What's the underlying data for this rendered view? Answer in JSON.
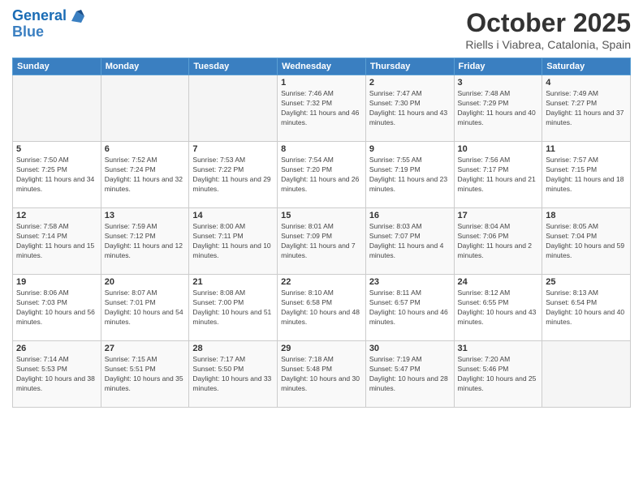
{
  "app": {
    "logo_line1": "General",
    "logo_line2": "Blue"
  },
  "header": {
    "month": "October 2025",
    "location": "Riells i Viabrea, Catalonia, Spain"
  },
  "weekdays": [
    "Sunday",
    "Monday",
    "Tuesday",
    "Wednesday",
    "Thursday",
    "Friday",
    "Saturday"
  ],
  "weeks": [
    [
      {
        "day": "",
        "sunrise": "",
        "sunset": "",
        "daylight": ""
      },
      {
        "day": "",
        "sunrise": "",
        "sunset": "",
        "daylight": ""
      },
      {
        "day": "",
        "sunrise": "",
        "sunset": "",
        "daylight": ""
      },
      {
        "day": "1",
        "sunrise": "Sunrise: 7:46 AM",
        "sunset": "Sunset: 7:32 PM",
        "daylight": "Daylight: 11 hours and 46 minutes."
      },
      {
        "day": "2",
        "sunrise": "Sunrise: 7:47 AM",
        "sunset": "Sunset: 7:30 PM",
        "daylight": "Daylight: 11 hours and 43 minutes."
      },
      {
        "day": "3",
        "sunrise": "Sunrise: 7:48 AM",
        "sunset": "Sunset: 7:29 PM",
        "daylight": "Daylight: 11 hours and 40 minutes."
      },
      {
        "day": "4",
        "sunrise": "Sunrise: 7:49 AM",
        "sunset": "Sunset: 7:27 PM",
        "daylight": "Daylight: 11 hours and 37 minutes."
      }
    ],
    [
      {
        "day": "5",
        "sunrise": "Sunrise: 7:50 AM",
        "sunset": "Sunset: 7:25 PM",
        "daylight": "Daylight: 11 hours and 34 minutes."
      },
      {
        "day": "6",
        "sunrise": "Sunrise: 7:52 AM",
        "sunset": "Sunset: 7:24 PM",
        "daylight": "Daylight: 11 hours and 32 minutes."
      },
      {
        "day": "7",
        "sunrise": "Sunrise: 7:53 AM",
        "sunset": "Sunset: 7:22 PM",
        "daylight": "Daylight: 11 hours and 29 minutes."
      },
      {
        "day": "8",
        "sunrise": "Sunrise: 7:54 AM",
        "sunset": "Sunset: 7:20 PM",
        "daylight": "Daylight: 11 hours and 26 minutes."
      },
      {
        "day": "9",
        "sunrise": "Sunrise: 7:55 AM",
        "sunset": "Sunset: 7:19 PM",
        "daylight": "Daylight: 11 hours and 23 minutes."
      },
      {
        "day": "10",
        "sunrise": "Sunrise: 7:56 AM",
        "sunset": "Sunset: 7:17 PM",
        "daylight": "Daylight: 11 hours and 21 minutes."
      },
      {
        "day": "11",
        "sunrise": "Sunrise: 7:57 AM",
        "sunset": "Sunset: 7:15 PM",
        "daylight": "Daylight: 11 hours and 18 minutes."
      }
    ],
    [
      {
        "day": "12",
        "sunrise": "Sunrise: 7:58 AM",
        "sunset": "Sunset: 7:14 PM",
        "daylight": "Daylight: 11 hours and 15 minutes."
      },
      {
        "day": "13",
        "sunrise": "Sunrise: 7:59 AM",
        "sunset": "Sunset: 7:12 PM",
        "daylight": "Daylight: 11 hours and 12 minutes."
      },
      {
        "day": "14",
        "sunrise": "Sunrise: 8:00 AM",
        "sunset": "Sunset: 7:11 PM",
        "daylight": "Daylight: 11 hours and 10 minutes."
      },
      {
        "day": "15",
        "sunrise": "Sunrise: 8:01 AM",
        "sunset": "Sunset: 7:09 PM",
        "daylight": "Daylight: 11 hours and 7 minutes."
      },
      {
        "day": "16",
        "sunrise": "Sunrise: 8:03 AM",
        "sunset": "Sunset: 7:07 PM",
        "daylight": "Daylight: 11 hours and 4 minutes."
      },
      {
        "day": "17",
        "sunrise": "Sunrise: 8:04 AM",
        "sunset": "Sunset: 7:06 PM",
        "daylight": "Daylight: 11 hours and 2 minutes."
      },
      {
        "day": "18",
        "sunrise": "Sunrise: 8:05 AM",
        "sunset": "Sunset: 7:04 PM",
        "daylight": "Daylight: 10 hours and 59 minutes."
      }
    ],
    [
      {
        "day": "19",
        "sunrise": "Sunrise: 8:06 AM",
        "sunset": "Sunset: 7:03 PM",
        "daylight": "Daylight: 10 hours and 56 minutes."
      },
      {
        "day": "20",
        "sunrise": "Sunrise: 8:07 AM",
        "sunset": "Sunset: 7:01 PM",
        "daylight": "Daylight: 10 hours and 54 minutes."
      },
      {
        "day": "21",
        "sunrise": "Sunrise: 8:08 AM",
        "sunset": "Sunset: 7:00 PM",
        "daylight": "Daylight: 10 hours and 51 minutes."
      },
      {
        "day": "22",
        "sunrise": "Sunrise: 8:10 AM",
        "sunset": "Sunset: 6:58 PM",
        "daylight": "Daylight: 10 hours and 48 minutes."
      },
      {
        "day": "23",
        "sunrise": "Sunrise: 8:11 AM",
        "sunset": "Sunset: 6:57 PM",
        "daylight": "Daylight: 10 hours and 46 minutes."
      },
      {
        "day": "24",
        "sunrise": "Sunrise: 8:12 AM",
        "sunset": "Sunset: 6:55 PM",
        "daylight": "Daylight: 10 hours and 43 minutes."
      },
      {
        "day": "25",
        "sunrise": "Sunrise: 8:13 AM",
        "sunset": "Sunset: 6:54 PM",
        "daylight": "Daylight: 10 hours and 40 minutes."
      }
    ],
    [
      {
        "day": "26",
        "sunrise": "Sunrise: 7:14 AM",
        "sunset": "Sunset: 5:53 PM",
        "daylight": "Daylight: 10 hours and 38 minutes."
      },
      {
        "day": "27",
        "sunrise": "Sunrise: 7:15 AM",
        "sunset": "Sunset: 5:51 PM",
        "daylight": "Daylight: 10 hours and 35 minutes."
      },
      {
        "day": "28",
        "sunrise": "Sunrise: 7:17 AM",
        "sunset": "Sunset: 5:50 PM",
        "daylight": "Daylight: 10 hours and 33 minutes."
      },
      {
        "day": "29",
        "sunrise": "Sunrise: 7:18 AM",
        "sunset": "Sunset: 5:48 PM",
        "daylight": "Daylight: 10 hours and 30 minutes."
      },
      {
        "day": "30",
        "sunrise": "Sunrise: 7:19 AM",
        "sunset": "Sunset: 5:47 PM",
        "daylight": "Daylight: 10 hours and 28 minutes."
      },
      {
        "day": "31",
        "sunrise": "Sunrise: 7:20 AM",
        "sunset": "Sunset: 5:46 PM",
        "daylight": "Daylight: 10 hours and 25 minutes."
      },
      {
        "day": "",
        "sunrise": "",
        "sunset": "",
        "daylight": ""
      }
    ]
  ]
}
